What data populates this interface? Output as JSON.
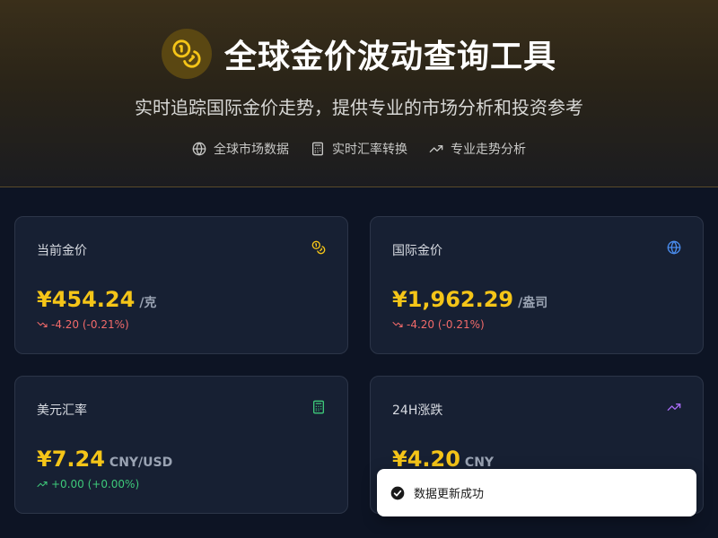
{
  "header": {
    "title": "全球金价波动查询工具",
    "subtitle": "实时追踪国际金价走势，提供专业的市场分析和投资参考",
    "features": [
      {
        "icon": "globe-icon",
        "label": "全球市场数据"
      },
      {
        "icon": "calculator-icon",
        "label": "实时汇率转换"
      },
      {
        "icon": "trending-up-icon",
        "label": "专业走势分析"
      }
    ]
  },
  "cards": [
    {
      "title": "当前金价",
      "icon": "coins-icon",
      "value": "¥454.24",
      "unit": "/克",
      "change": "-4.20 (-0.21%)",
      "direction": "down"
    },
    {
      "title": "国际金价",
      "icon": "globe-icon",
      "value": "¥1,962.29",
      "unit": "/盎司",
      "change": "-4.20 (-0.21%)",
      "direction": "down"
    },
    {
      "title": "美元汇率",
      "icon": "calculator-icon",
      "value": "¥7.24",
      "unit": "CNY/USD",
      "change": "+0.00 (+0.00%)",
      "direction": "up"
    },
    {
      "title": "24H涨跌",
      "icon": "trending-up-icon",
      "value": "¥4.20",
      "unit": "CNY",
      "change": "",
      "direction": "up"
    }
  ],
  "toast": {
    "message": "数据更新成功"
  },
  "colors": {
    "gold": "#f5c518",
    "down": "#f26a6a",
    "up": "#3ec97a",
    "globe_blue": "#4a8df0",
    "calc_green": "#3ec97a",
    "trend_purple": "#a86bf5"
  }
}
